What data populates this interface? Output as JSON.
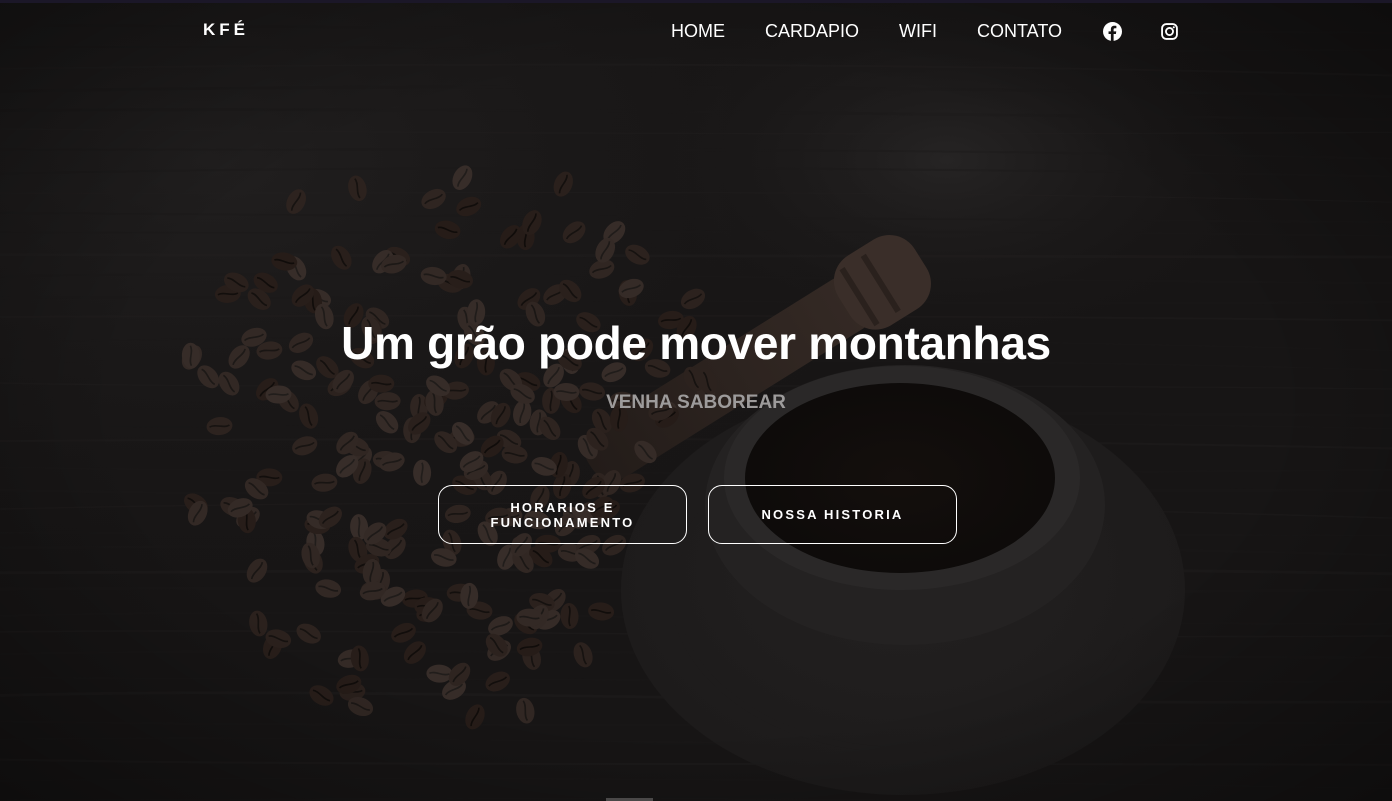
{
  "brand": {
    "logo": "KFÉ"
  },
  "nav": {
    "items": [
      {
        "label": "HOME"
      },
      {
        "label": "CARDAPIO"
      },
      {
        "label": "WIFI"
      },
      {
        "label": "CONTATO"
      }
    ],
    "social": [
      {
        "icon": "facebook-icon"
      },
      {
        "icon": "instagram-icon"
      }
    ]
  },
  "hero": {
    "title": "Um grão pode mover montanhas",
    "subtitle": "VENHA SABOREAR",
    "buttons": [
      {
        "label": "HORARIOS E FUNCIONAMENTO"
      },
      {
        "label": "NOSSA HISTORIA"
      }
    ]
  },
  "colors": {
    "background": "#171515",
    "text": "#ffffff",
    "subtitle": "#9d9b9b",
    "top_line": "#1b1728"
  }
}
